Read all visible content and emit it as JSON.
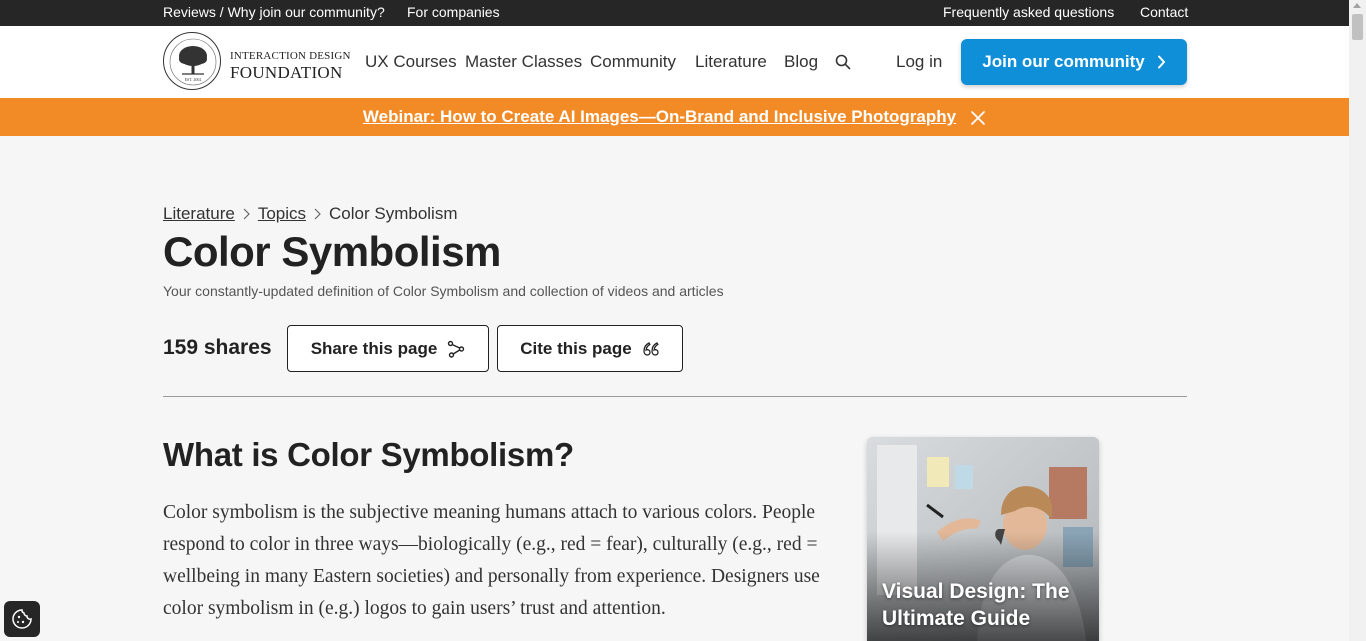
{
  "topbar": {
    "reviews": "Reviews / Why join our community?",
    "companies": "For companies",
    "faq": "Frequently asked questions",
    "contact": "Contact"
  },
  "header": {
    "logo_line1": "INTERACTION DESIGN",
    "logo_line2": "FOUNDATION",
    "logo_est": "EST. 2002",
    "nav": [
      "UX Courses",
      "Master Classes",
      "Community",
      "Literature",
      "Blog"
    ],
    "login": "Log in",
    "join": "Join our community"
  },
  "banner": {
    "text": "Webinar: How to Create AI Images—On-Brand and Inclusive Photography",
    "color": "#f28a26"
  },
  "breadcrumb": [
    "Literature",
    "Topics",
    "Color Symbolism"
  ],
  "page": {
    "title": "Color Symbolism",
    "subtitle": "Your constantly-updated definition of Color Symbolism and collection of videos and articles",
    "shares": "159 shares",
    "share_button": "Share this page",
    "cite_button": "Cite this page"
  },
  "section": {
    "title": "What is Color Symbolism?",
    "body": "Color symbolism is the subjective meaning humans attach to various colors. People respond to color in three ways—biologically (e.g., red = fear), culturally (e.g., red = wellbeing in many Eastern societies) and personally from experience. Designers use color symbolism in (e.g.) logos to gain users’ trust and attention."
  },
  "card": {
    "title": "Visual Design: The Ultimate Guide"
  },
  "colors": {
    "accent": "#0f8fd8",
    "topbar": "#262626"
  },
  "icons": {
    "search": "search-icon",
    "chevron": "chevron-right-icon",
    "close": "close-icon",
    "share": "share-icon",
    "quote": "quote-icon",
    "cookie": "cookie-icon"
  }
}
